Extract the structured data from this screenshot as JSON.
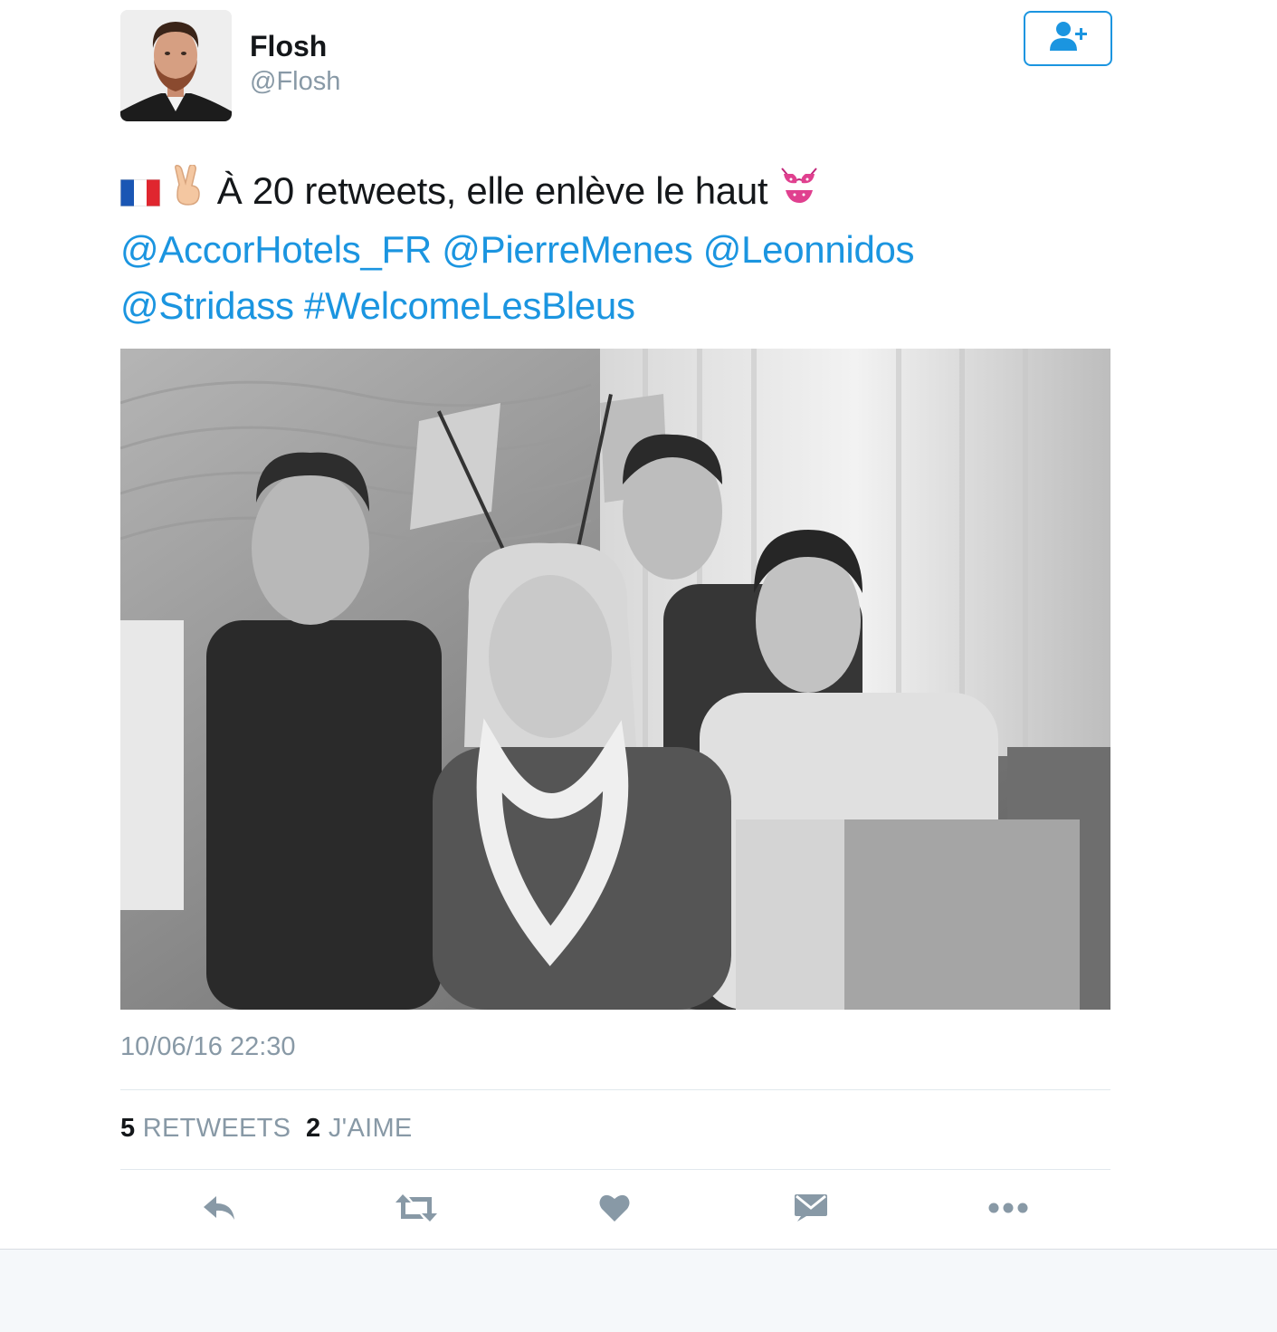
{
  "colors": {
    "accent": "#1b95e0",
    "muted": "#8899a6",
    "text": "#14171a"
  },
  "user": {
    "name": "Flosh",
    "handle": "@Flosh",
    "avatar_icon": "profile-photo",
    "follow_icon": "add-user-icon"
  },
  "tweet": {
    "emojis": [
      "flag-france-icon",
      "victory-hand-icon",
      "bikini-icon"
    ],
    "text": "À 20 retweets, elle enlève le haut",
    "mentions": [
      "@AccorHotels_FR",
      "@PierreMenes",
      "@Leonnidos",
      "@Stridass"
    ],
    "hashtag": "#WelcomeLesBleus",
    "photo_icon": "group-photo",
    "timestamp": "10/06/16 22:30"
  },
  "stats": {
    "retweets_count": "5",
    "retweets_label": "RETWEETS",
    "likes_count": "2",
    "likes_label": "J'AIME"
  },
  "actions": [
    "reply-icon",
    "retweet-icon",
    "like-icon",
    "message-icon",
    "more-icon"
  ]
}
